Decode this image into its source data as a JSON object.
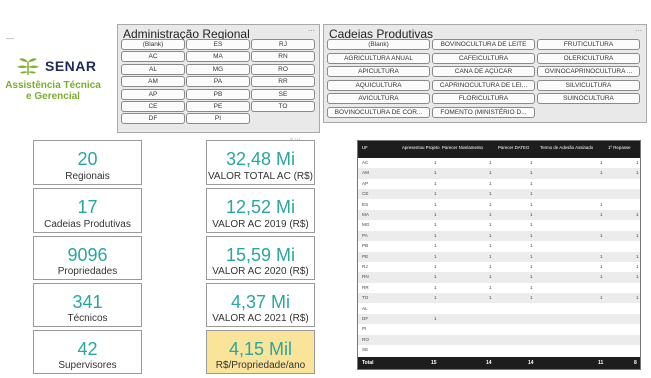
{
  "logo": {
    "top_caption": "—",
    "name": "SENAR",
    "subtitle_1": "Assistência Técnica",
    "subtitle_2": "e Gerencial"
  },
  "admin_slicer": {
    "title": "Administração Regional",
    "items": [
      "(Blank)",
      "ES",
      "RJ",
      "AC",
      "MA",
      "RN",
      "AL",
      "MG",
      "RO",
      "AM",
      "PA",
      "RR",
      "AP",
      "PB",
      "SE",
      "CE",
      "PE",
      "TO",
      "DF",
      "PI"
    ]
  },
  "chain_slicer": {
    "title": "Cadeias Produtivas",
    "items": [
      "(Blank)",
      "BOVINOCULTURA DE LEITE",
      "FRUTICULTURA",
      "AGRICULTURA ANUAL",
      "CAFEICULTURA",
      "OLERICULTURA",
      "APICULTURA",
      "CANA DE AÇÚCAR",
      "OVINOCAPRINOCULTURA ...",
      "AQUICULTURA",
      "CAPRINOCULTURA DE LEI...",
      "SILVICULTURA",
      "AVICULTURA",
      "FLORICULTURA",
      "SUINOCULTURA",
      "BOVINOCULTURA DE COR...",
      "FOMENTO (MINISTÉRIO D..."
    ]
  },
  "kpi_left": [
    {
      "value": "20",
      "label": "Regionais"
    },
    {
      "value": "17",
      "label": "Cadeias Produtivas"
    },
    {
      "value": "9096",
      "label": "Propriedades"
    },
    {
      "value": "341",
      "label": "Técnicos"
    },
    {
      "value": "42",
      "label": "Supervisores"
    }
  ],
  "kpi_right": [
    {
      "value": "32,48 Mi",
      "label": "VALOR TOTAL AC (R$)"
    },
    {
      "value": "12,52 Mi",
      "label": "VALOR AC 2019 (R$)"
    },
    {
      "value": "15,59 Mi",
      "label": "VALOR AC 2020 (R$)"
    },
    {
      "value": "4,37 Mi",
      "label": "VALOR AC 2021 (R$)"
    },
    {
      "value": "4,15 Mil",
      "label": "R$/Propriedade/ano"
    }
  ],
  "table": {
    "columns": [
      "UF",
      "Apresentou Projeto",
      "Parecer Nivelamento",
      "Parecer DATEG",
      "Termo de Adesão Assinado",
      "1º Repasse"
    ],
    "rows": [
      [
        "AC",
        "1",
        "1",
        "1",
        "1",
        "1"
      ],
      [
        "AM",
        "1",
        "1",
        "1",
        "1",
        "1"
      ],
      [
        "AP",
        "1",
        "1",
        "1",
        "",
        ""
      ],
      [
        "CE",
        "1",
        "1",
        "1",
        "",
        ""
      ],
      [
        "ES",
        "1",
        "1",
        "1",
        "1",
        ""
      ],
      [
        "MA",
        "1",
        "1",
        "1",
        "1",
        "1"
      ],
      [
        "MG",
        "1",
        "1",
        "1",
        "",
        ""
      ],
      [
        "PA",
        "1",
        "1",
        "1",
        "1",
        "1"
      ],
      [
        "PB",
        "1",
        "1",
        "1",
        "",
        ""
      ],
      [
        "PE",
        "1",
        "1",
        "1",
        "1",
        "1"
      ],
      [
        "RJ",
        "1",
        "1",
        "1",
        "1",
        "1"
      ],
      [
        "RN",
        "1",
        "1",
        "1",
        "1",
        "1"
      ],
      [
        "RR",
        "1",
        "1",
        "1",
        "",
        ""
      ],
      [
        "TO",
        "1",
        "1",
        "1",
        "1",
        "1"
      ],
      [
        "AL",
        "",
        "",
        "",
        "",
        ""
      ],
      [
        "DF",
        "1",
        "",
        "",
        "",
        ""
      ],
      [
        "PI",
        "",
        "",
        "",
        "",
        ""
      ],
      [
        "RO",
        "",
        "",
        "",
        "",
        ""
      ],
      [
        "SE",
        "",
        "",
        "",
        "",
        ""
      ]
    ],
    "totals": [
      "Total",
      "15",
      "14",
      "14",
      "11",
      "8"
    ]
  },
  "colors": {
    "accent": "#28a79e",
    "highlight": "#f9e49a",
    "header": "#1d1d1d",
    "logo_green": "#7aae2c",
    "logo_navy": "#1f2a5c"
  }
}
